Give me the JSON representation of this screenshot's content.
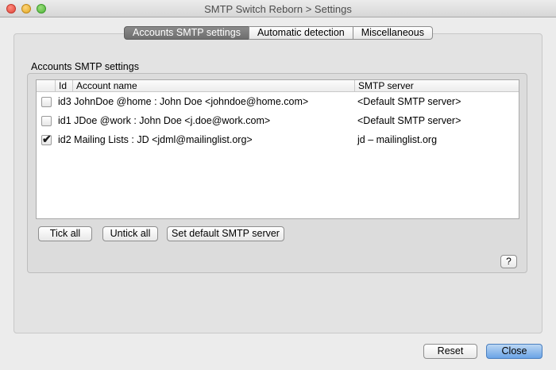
{
  "window": {
    "title": "SMTP Switch Reborn > Settings"
  },
  "tabs": [
    {
      "label": "Accounts SMTP settings",
      "active": true
    },
    {
      "label": "Automatic detection",
      "active": false
    },
    {
      "label": "Miscellaneous",
      "active": false
    }
  ],
  "group": {
    "label": "Accounts SMTP settings"
  },
  "table": {
    "columns": {
      "id": "Id",
      "account": "Account name",
      "server": "SMTP server"
    },
    "rows": [
      {
        "checked": false,
        "account": "id3 JohnDoe @home : John Doe <johndoe@home.com>",
        "server": "<Default SMTP server>"
      },
      {
        "checked": false,
        "account": "id1 JDoe @work : John Doe <j.doe@work.com>",
        "server": "<Default SMTP server>"
      },
      {
        "checked": true,
        "account": "id2 Mailing Lists : JD <jdml@mailinglist.org>",
        "server": "jd – mailinglist.org"
      }
    ]
  },
  "buttons": {
    "tick_all": "Tick all",
    "untick_all": "Untick all",
    "set_default": "Set default SMTP server",
    "help": "?",
    "reset": "Reset",
    "close": "Close"
  },
  "icons": {
    "close": "close-traffic-light-icon",
    "minimize": "minimize-traffic-light-icon",
    "zoom": "zoom-traffic-light-icon",
    "check": "checkmark-icon"
  },
  "colors": {
    "close_light": "#e0443a",
    "minimize_light": "#e0a823",
    "zoom_light": "#4fb43a",
    "active_tab": "#7a7a7a",
    "default_button": "#6aa3e6"
  }
}
